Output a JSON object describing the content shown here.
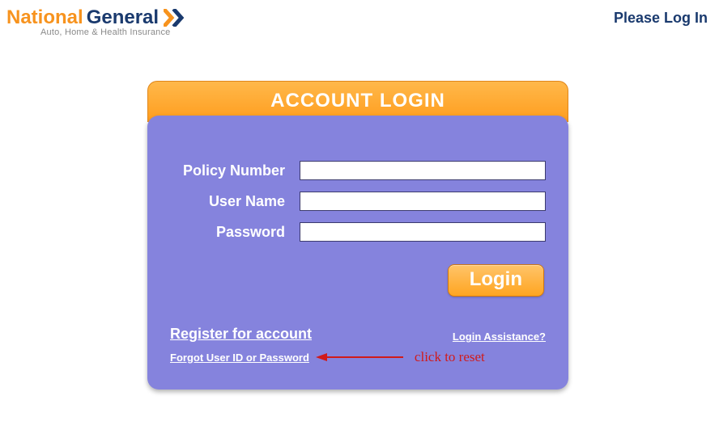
{
  "header": {
    "logo_national": "National",
    "logo_general": "General",
    "tagline": "Auto, Home & Health Insurance",
    "login_link": "Please Log In"
  },
  "login": {
    "title": "ACCOUNT LOGIN",
    "fields": {
      "policy_label": "Policy Number",
      "policy_value": "",
      "username_label": "User Name",
      "username_value": "",
      "password_label": "Password",
      "password_value": ""
    },
    "button_label": "Login",
    "register_link": "Register for account",
    "assist_link": "Login Assistance?",
    "forgot_link": "Forgot User ID or Password"
  },
  "annotation": {
    "text": "click to reset"
  },
  "colors": {
    "brand_orange": "#f7931e",
    "brand_blue": "#1a3a6e",
    "panel_purple": "#8583dd",
    "button_orange": "#ffa521"
  }
}
